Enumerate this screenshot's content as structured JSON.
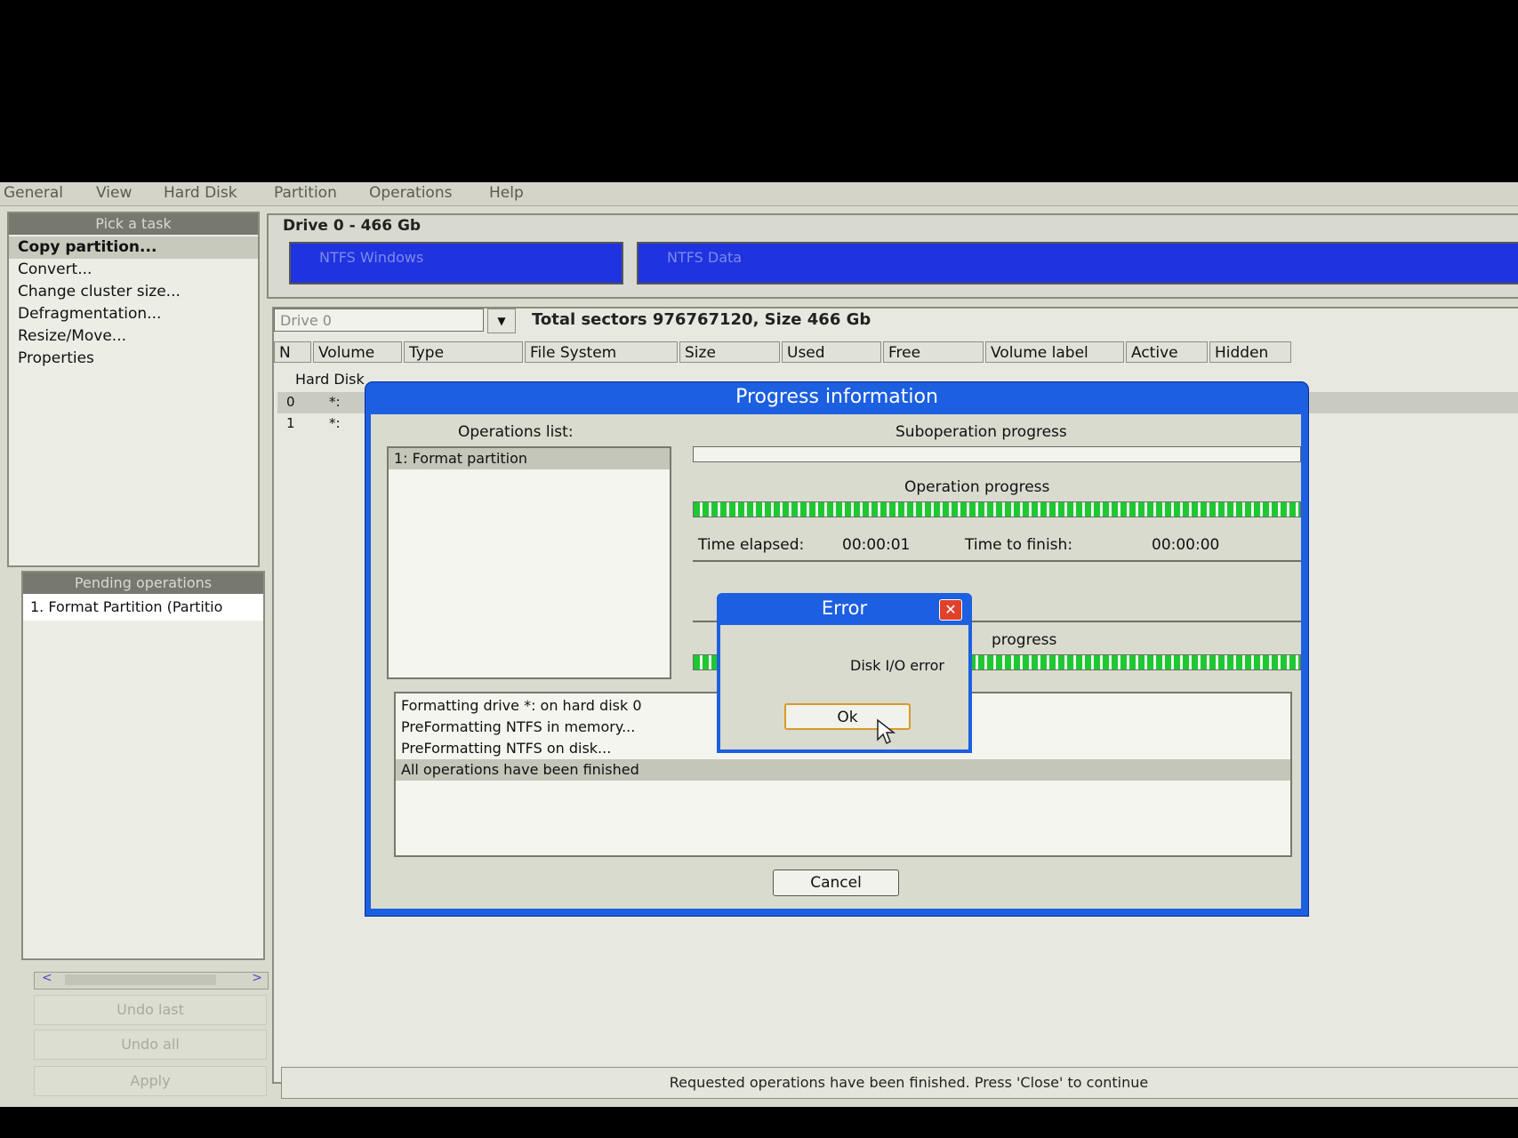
{
  "menu": [
    "General",
    "View",
    "Hard Disk",
    "Partition",
    "Operations",
    "Help"
  ],
  "tasks": {
    "title": "Pick a task",
    "items": [
      "Copy partition...",
      "Convert...",
      "Change cluster size...",
      "Defragmentation...",
      "Resize/Move...",
      "Properties"
    ]
  },
  "pending": {
    "title": "Pending operations",
    "items": [
      "1. Format Partition (Partitio"
    ],
    "undo_last": "Undo last",
    "undo_all": "Undo all",
    "apply": "Apply"
  },
  "drive_map": {
    "title": "Drive 0 - 466 Gb",
    "partitions": [
      "NTFS Windows",
      "NTFS Data"
    ]
  },
  "table": {
    "drive_select": "Drive 0",
    "sectors_info": "Total sectors 976767120, Size 466 Gb",
    "columns": [
      "N",
      "Volume",
      "Type",
      "File System",
      "Size",
      "Used",
      "Free",
      "Volume label",
      "Active",
      "Hidden"
    ],
    "group": "Hard Disk",
    "rows": [
      {
        "n": "0",
        "volume": "*:"
      },
      {
        "n": "1",
        "volume": "*:"
      }
    ]
  },
  "status": "Requested operations have been finished. Press 'Close' to continue",
  "progress_dialog": {
    "title": "Progress information",
    "ops_list_label": "Operations list:",
    "ops_items": [
      "1: Format partition"
    ],
    "suboperation_label": "Suboperation progress",
    "suboperation_progress": 0,
    "operation_label": "Operation progress",
    "operation_progress": 100,
    "time_elapsed_label": "Time elapsed:",
    "time_elapsed": "00:00:01",
    "time_to_finish_label": "Time to finish:",
    "time_to_finish": "00:00:00",
    "total_label": "progress",
    "total_progress": 100,
    "log": [
      "Formatting drive *: on hard disk 0",
      "PreFormatting NTFS in memory...",
      "PreFormatting NTFS on disk...",
      "All operations have been finished"
    ],
    "cancel_label": "Cancel"
  },
  "error_dialog": {
    "title": "Error",
    "close_symbol": "✕",
    "message": "Disk I/O error",
    "ok_label": "Ok"
  }
}
